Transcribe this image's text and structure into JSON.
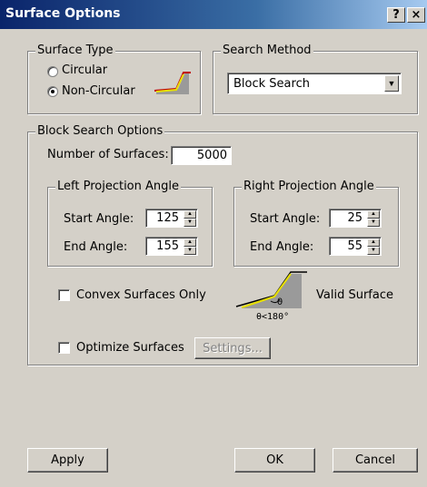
{
  "window": {
    "title": "Surface Options",
    "help_label": "?",
    "close_label": "×"
  },
  "surface_type": {
    "legend": "Surface Type",
    "options": [
      "Circular",
      "Non-Circular"
    ],
    "selected": "Non-Circular"
  },
  "search_method": {
    "legend": "Search Method",
    "selected": "Block Search"
  },
  "block_search": {
    "legend": "Block Search Options",
    "num_surfaces_label": "Number of Surfaces:",
    "num_surfaces_value": "5000",
    "left": {
      "legend": "Left Projection Angle",
      "start_label": "Start Angle:",
      "start_value": "125",
      "end_label": "End Angle:",
      "end_value": "155"
    },
    "right": {
      "legend": "Right Projection Angle",
      "start_label": "Start Angle:",
      "start_value": "25",
      "end_label": "End Angle:",
      "end_value": "55"
    },
    "convex_label": "Convex Surfaces Only",
    "convex_checked": false,
    "diagram_theta": "θ",
    "diagram_condition": "θ<180°",
    "valid_surface_label": "Valid Surface",
    "optimize_label": "Optimize Surfaces",
    "optimize_checked": false,
    "settings_label": "Settings..."
  },
  "buttons": {
    "apply": "Apply",
    "ok": "OK",
    "cancel": "Cancel"
  },
  "colors": {
    "titlebar_start": "#0a246a",
    "titlebar_end": "#a6caf0",
    "dialog_bg": "#d4d0c8",
    "surface_line": "#e8e000",
    "surface_edge": "#c00000"
  }
}
